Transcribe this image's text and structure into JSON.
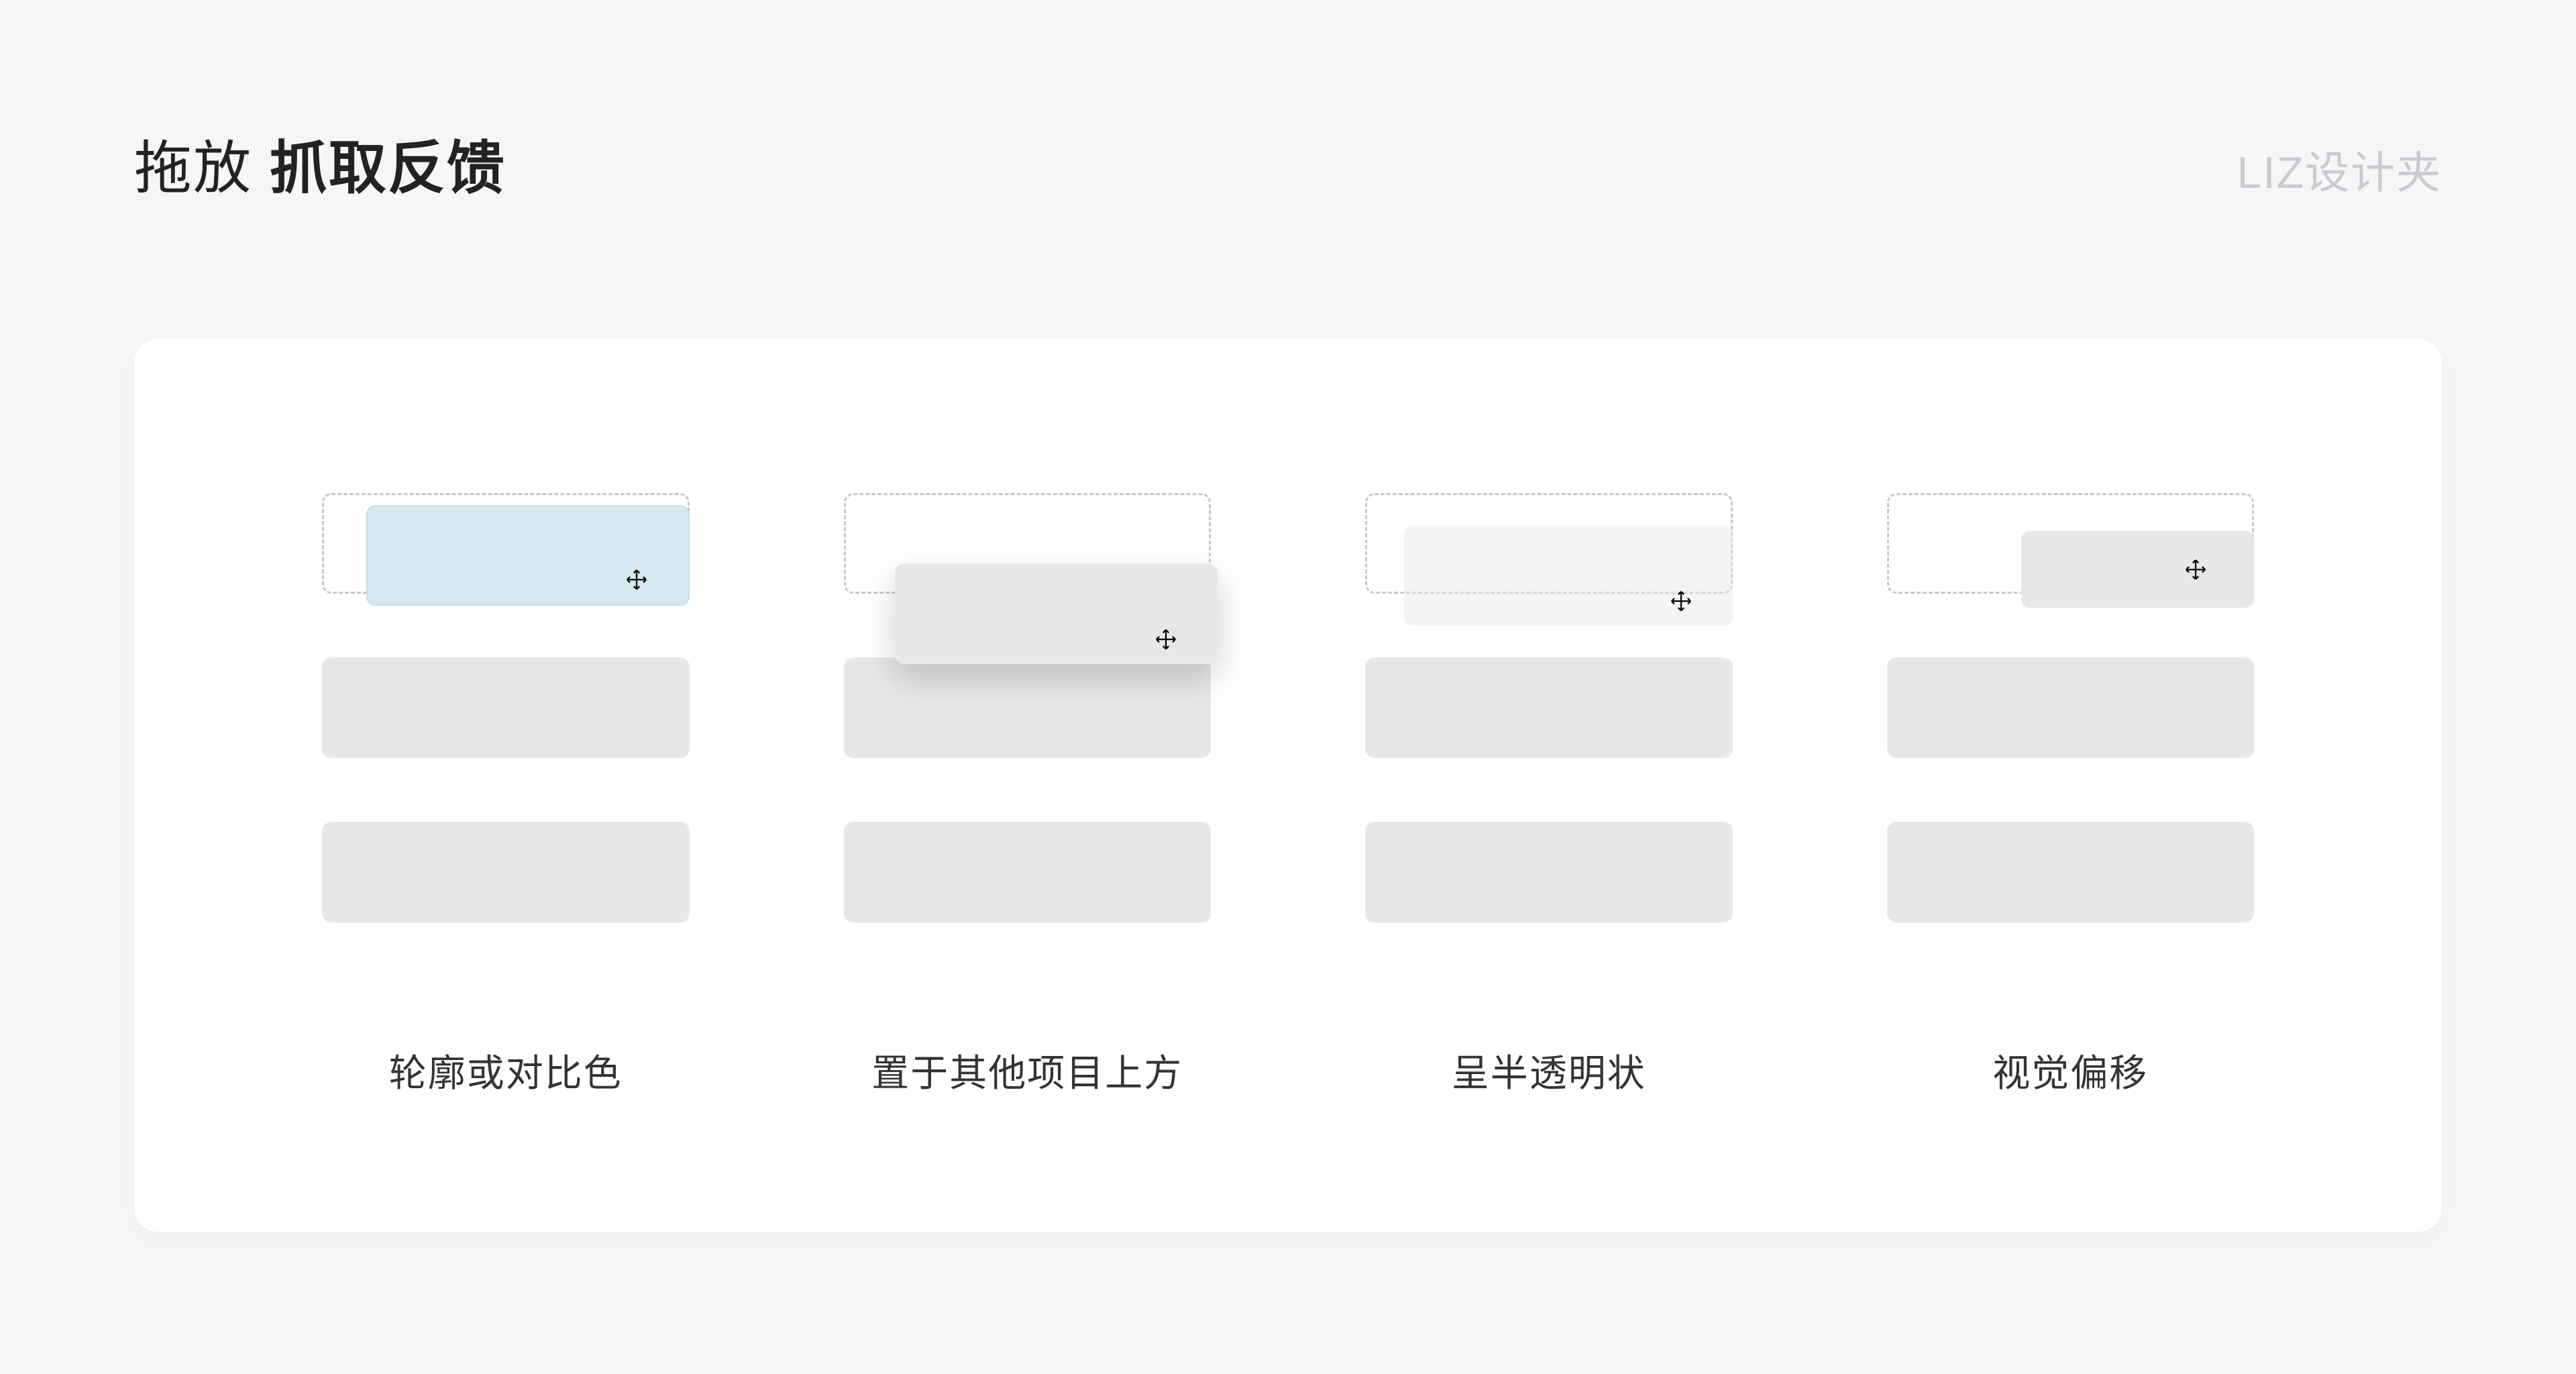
{
  "title_prefix": "拖放 ",
  "title_bold": "抓取反馈",
  "brand": "LIZ设计夹",
  "examples": [
    {
      "caption": "轮廓或对比色"
    },
    {
      "caption": "置于其他项目上方"
    },
    {
      "caption": "呈半透明状"
    },
    {
      "caption": "视觉偏移"
    }
  ]
}
